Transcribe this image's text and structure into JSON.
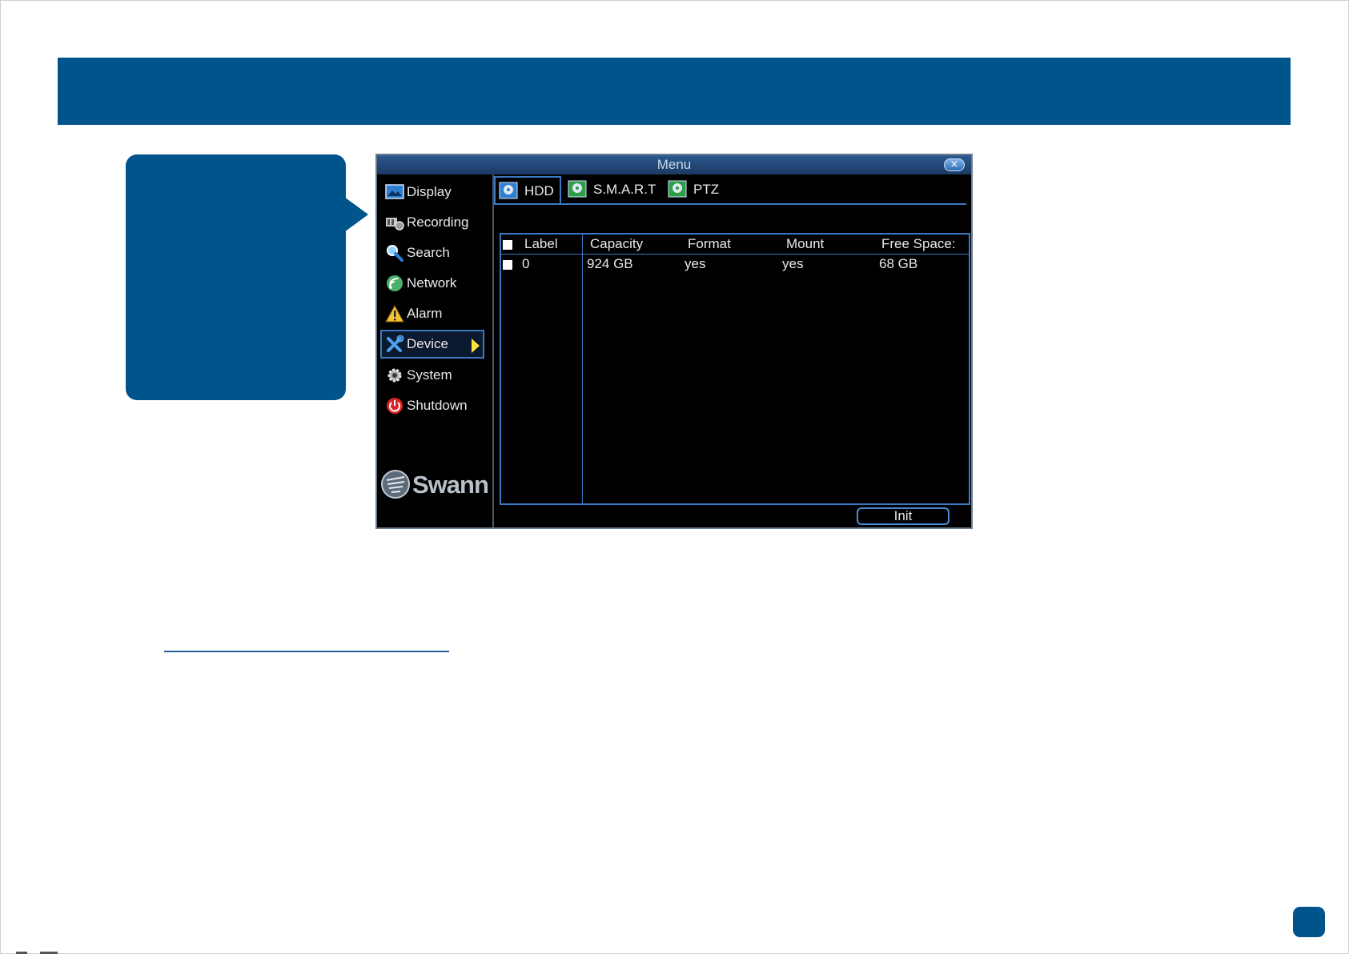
{
  "colors": {
    "brand": "#00548c",
    "accent": "#3b79c4",
    "selected_arrow": "#ffe33a"
  },
  "window": {
    "title": "Menu",
    "close_label": "×"
  },
  "sidebar": {
    "items": [
      {
        "label": "Display",
        "icon": "display-icon"
      },
      {
        "label": "Recording",
        "icon": "recording-icon"
      },
      {
        "label": "Search",
        "icon": "search-icon"
      },
      {
        "label": "Network",
        "icon": "network-icon"
      },
      {
        "label": "Alarm",
        "icon": "alarm-icon"
      },
      {
        "label": "Device",
        "icon": "device-icon",
        "selected": true
      },
      {
        "label": "System",
        "icon": "gear-icon"
      },
      {
        "label": "Shutdown",
        "icon": "power-icon"
      }
    ],
    "logo_text": "Swann"
  },
  "tabs": [
    {
      "label": "HDD",
      "active": true
    },
    {
      "label": "S.M.A.R.T",
      "active": false
    },
    {
      "label": "PTZ",
      "active": false
    }
  ],
  "table": {
    "headers": [
      "Label",
      "Capacity",
      "Format",
      "Mount",
      "Free Space:"
    ],
    "rows": [
      {
        "label": "0",
        "capacity": "924 GB",
        "format": "yes",
        "mount": "yes",
        "free_space": "68 GB"
      }
    ]
  },
  "buttons": {
    "init": "Init"
  }
}
